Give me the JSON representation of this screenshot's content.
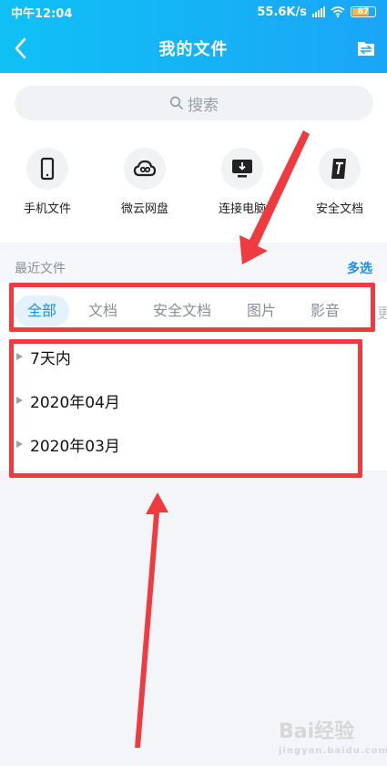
{
  "status_bar": {
    "time": "中午12:04",
    "network_speed": "55.6K/s",
    "battery": "87"
  },
  "nav": {
    "title": "我的文件"
  },
  "search": {
    "placeholder": "搜索"
  },
  "quick_actions": [
    {
      "label": "手机文件",
      "icon": "phone-icon"
    },
    {
      "label": "微云网盘",
      "icon": "cloud-icon"
    },
    {
      "label": "连接电脑",
      "icon": "monitor-icon"
    },
    {
      "label": "安全文档",
      "icon": "secure-doc-icon"
    }
  ],
  "recent": {
    "title": "最近文件",
    "multi_select": "多选"
  },
  "tabs": [
    {
      "label": "全部",
      "active": true
    },
    {
      "label": "文档"
    },
    {
      "label": "安全文档"
    },
    {
      "label": "图片"
    },
    {
      "label": "影音"
    }
  ],
  "groups": [
    {
      "label": "7天内"
    },
    {
      "label": "2020年04月"
    },
    {
      "label": "2020年03月"
    }
  ],
  "watermark": {
    "text": "Bai经验",
    "sub": "jingyan.baidu.com"
  },
  "colors": {
    "header": "#12b5f6",
    "accent": "#1a8ff0",
    "annotation": "#ef3b3f"
  }
}
